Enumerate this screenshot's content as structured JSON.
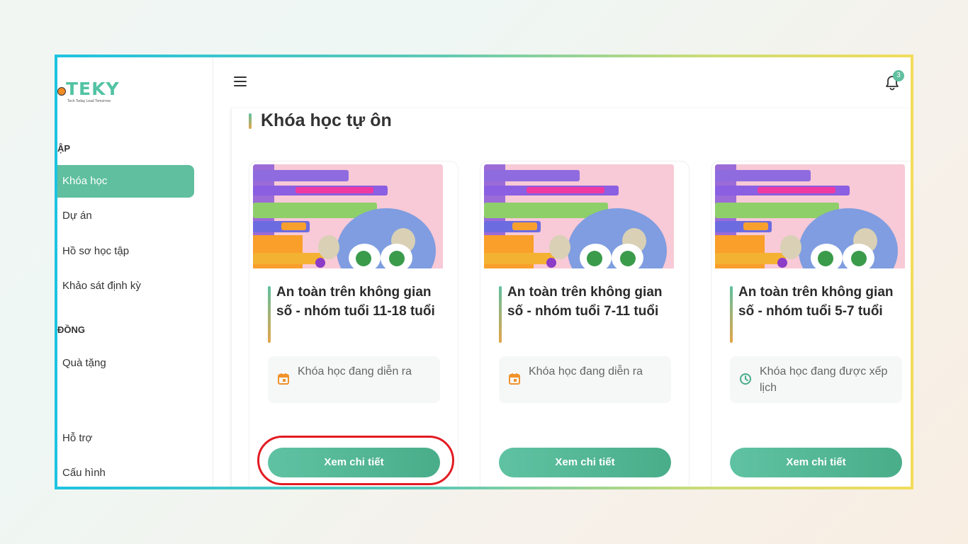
{
  "brand": {
    "name": "TEKY",
    "tagline": "Tech Today Lead Tomorrow",
    "accent": "#5fbf9f"
  },
  "sidebar": {
    "section1": "ẬP",
    "section2": "ĐỒNG",
    "items": [
      {
        "label": "Khóa học",
        "active": true
      },
      {
        "label": "Dự án"
      },
      {
        "label": "Hồ sơ học tập"
      },
      {
        "label": "Khảo sát định kỳ"
      }
    ],
    "items2": [
      {
        "label": "Quà tặng"
      }
    ],
    "bottom": [
      {
        "label": "Hỗ trợ"
      },
      {
        "label": "Cấu hình"
      }
    ]
  },
  "header": {
    "menu_icon": "hamburger-icon",
    "notification_icon": "bell-icon",
    "notification_count": "3"
  },
  "main": {
    "title": "Khóa học tự ôn",
    "cards": [
      {
        "title": "An toàn trên không gian số - nhóm tuổi 11-18 tuổi",
        "status_icon": "calendar-icon",
        "status": "Khóa học đang diễn ra",
        "button": "Xem chi tiết"
      },
      {
        "title": "An toàn trên không gian số - nhóm tuổi 7-11 tuổi",
        "status_icon": "calendar-icon",
        "status": "Khóa học đang diễn ra",
        "button": "Xem chi tiết"
      },
      {
        "title": "An toàn trên không gian số - nhóm tuổi 5-7 tuổi",
        "status_icon": "clock-icon",
        "status": "Khóa học đang được xếp lịch",
        "button": "Xem chi tiết"
      }
    ]
  }
}
